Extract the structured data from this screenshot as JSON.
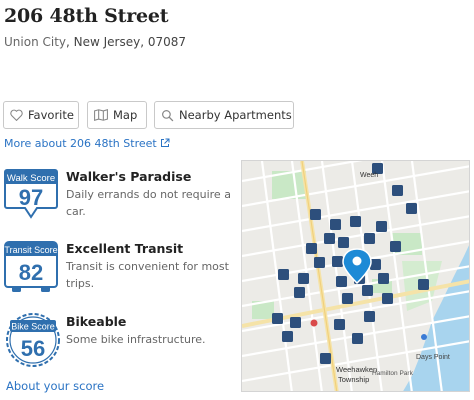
{
  "header": {
    "title": "206 48th Street",
    "city": "Union City",
    "rest": ", New Jersey, 07087"
  },
  "buttons": {
    "favorite": "Favorite",
    "map": "Map",
    "nearby": "Nearby Apartments"
  },
  "links": {
    "more_about": "More about 206 48th Street",
    "about_score": "About your score"
  },
  "scores": [
    {
      "badge_title": "Walk Score",
      "value": "97",
      "label": "Walker's Paradise",
      "desc": "Daily errands do not require a car."
    },
    {
      "badge_title": "Transit Score",
      "value": "82",
      "label": "Excellent Transit",
      "desc": "Transit is convenient for most trips."
    },
    {
      "badge_title": "Bike Score",
      "value": "56",
      "label": "Bikeable",
      "desc": "Some bike infrastructure."
    }
  ],
  "map": {
    "labels": {
      "weehawken": "Weehawken",
      "township": "Township",
      "days_point": "Days Point",
      "hamilton_park": "Hamilton Park",
      "weehawken_top": "Weeh"
    }
  },
  "colors": {
    "badge": "#2f6fae",
    "link": "#2a73c4",
    "map_water": "#a8d4ee",
    "map_green": "#c9e8c6",
    "map_marker": "#1d8ad6"
  }
}
